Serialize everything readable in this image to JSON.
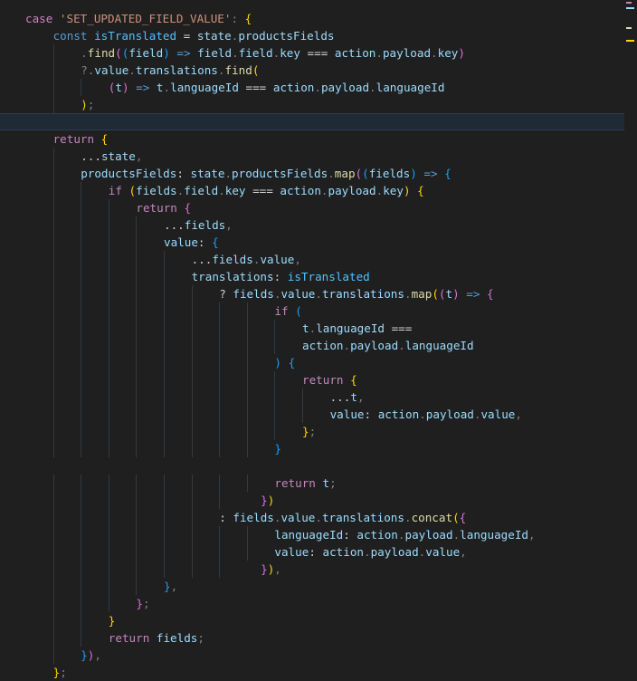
{
  "colors": {
    "background": "#1f1f1f",
    "current_line": "#1e2a35",
    "keyword_control": "#c586c0",
    "keyword_storage": "#569cd6",
    "variable": "#9cdcfe",
    "constant": "#4fc1ff",
    "function": "#dcdcaa",
    "string": "#ce9178",
    "punctuation": "#d4d4d4",
    "dim_punctuation": "#808080",
    "bracket1": "#ffd700",
    "bracket2": "#da70d6",
    "bracket3": "#179fff"
  },
  "editor": {
    "lines": [
      {
        "indent": 0,
        "tokens": [
          {
            "t": "case ",
            "c": "keyword_control"
          },
          {
            "t": "'SET_UPDATED_FIELD_VALUE'",
            "c": "string"
          },
          {
            "t": ": ",
            "c": "dim_punctuation"
          },
          {
            "t": "{",
            "c": "bracket1"
          }
        ]
      },
      {
        "indent": 1,
        "tokens": [
          {
            "t": "const ",
            "c": "keyword_storage"
          },
          {
            "t": "isTranslated",
            "c": "constant"
          },
          {
            "t": " = ",
            "c": "punctuation"
          },
          {
            "t": "state",
            "c": "variable"
          },
          {
            "t": ".",
            "c": "dim_punctuation"
          },
          {
            "t": "productsFields",
            "c": "variable"
          }
        ]
      },
      {
        "indent": 2,
        "tokens": [
          {
            "t": ".",
            "c": "dim_punctuation"
          },
          {
            "t": "find",
            "c": "function"
          },
          {
            "t": "(",
            "c": "bracket2"
          },
          {
            "t": "(",
            "c": "bracket3"
          },
          {
            "t": "field",
            "c": "variable"
          },
          {
            "t": ")",
            "c": "bracket3"
          },
          {
            "t": " => ",
            "c": "keyword_storage"
          },
          {
            "t": "field",
            "c": "variable"
          },
          {
            "t": ".",
            "c": "dim_punctuation"
          },
          {
            "t": "field",
            "c": "variable"
          },
          {
            "t": ".",
            "c": "dim_punctuation"
          },
          {
            "t": "key",
            "c": "variable"
          },
          {
            "t": " === ",
            "c": "punctuation"
          },
          {
            "t": "action",
            "c": "variable"
          },
          {
            "t": ".",
            "c": "dim_punctuation"
          },
          {
            "t": "payload",
            "c": "variable"
          },
          {
            "t": ".",
            "c": "dim_punctuation"
          },
          {
            "t": "key",
            "c": "variable"
          },
          {
            "t": ")",
            "c": "bracket2"
          }
        ]
      },
      {
        "indent": 2,
        "tokens": [
          {
            "t": "?.",
            "c": "dim_punctuation"
          },
          {
            "t": "value",
            "c": "variable"
          },
          {
            "t": ".",
            "c": "dim_punctuation"
          },
          {
            "t": "translations",
            "c": "variable"
          },
          {
            "t": ".",
            "c": "dim_punctuation"
          },
          {
            "t": "find",
            "c": "function"
          },
          {
            "t": "(",
            "c": "bracket1"
          }
        ]
      },
      {
        "indent": 3,
        "tokens": [
          {
            "t": "(",
            "c": "bracket2"
          },
          {
            "t": "t",
            "c": "variable"
          },
          {
            "t": ")",
            "c": "bracket2"
          },
          {
            "t": " => ",
            "c": "keyword_storage"
          },
          {
            "t": "t",
            "c": "variable"
          },
          {
            "t": ".",
            "c": "dim_punctuation"
          },
          {
            "t": "languageId",
            "c": "variable"
          },
          {
            "t": " === ",
            "c": "punctuation"
          },
          {
            "t": "action",
            "c": "variable"
          },
          {
            "t": ".",
            "c": "dim_punctuation"
          },
          {
            "t": "payload",
            "c": "variable"
          },
          {
            "t": ".",
            "c": "dim_punctuation"
          },
          {
            "t": "languageId",
            "c": "variable"
          }
        ]
      },
      {
        "indent": 2,
        "tokens": [
          {
            "t": ")",
            "c": "bracket1"
          },
          {
            "t": ";",
            "c": "dim_punctuation"
          }
        ]
      },
      {
        "indent": 0,
        "current": true,
        "tokens": []
      },
      {
        "indent": 1,
        "tokens": [
          {
            "t": "return ",
            "c": "keyword_control"
          },
          {
            "t": "{",
            "c": "bracket1"
          }
        ]
      },
      {
        "indent": 2,
        "tokens": [
          {
            "t": "...",
            "c": "punctuation"
          },
          {
            "t": "state",
            "c": "variable"
          },
          {
            "t": ",",
            "c": "dim_punctuation"
          }
        ]
      },
      {
        "indent": 2,
        "tokens": [
          {
            "t": "productsFields",
            "c": "variable"
          },
          {
            "t": ": ",
            "c": "punctuation"
          },
          {
            "t": "state",
            "c": "variable"
          },
          {
            "t": ".",
            "c": "dim_punctuation"
          },
          {
            "t": "productsFields",
            "c": "variable"
          },
          {
            "t": ".",
            "c": "dim_punctuation"
          },
          {
            "t": "map",
            "c": "function"
          },
          {
            "t": "(",
            "c": "bracket2"
          },
          {
            "t": "(",
            "c": "bracket3"
          },
          {
            "t": "fields",
            "c": "variable"
          },
          {
            "t": ")",
            "c": "bracket3"
          },
          {
            "t": " => ",
            "c": "keyword_storage"
          },
          {
            "t": "{",
            "c": "bracket3"
          }
        ]
      },
      {
        "indent": 3,
        "tokens": [
          {
            "t": "if ",
            "c": "keyword_control"
          },
          {
            "t": "(",
            "c": "bracket1"
          },
          {
            "t": "fields",
            "c": "variable"
          },
          {
            "t": ".",
            "c": "dim_punctuation"
          },
          {
            "t": "field",
            "c": "variable"
          },
          {
            "t": ".",
            "c": "dim_punctuation"
          },
          {
            "t": "key",
            "c": "variable"
          },
          {
            "t": " === ",
            "c": "punctuation"
          },
          {
            "t": "action",
            "c": "variable"
          },
          {
            "t": ".",
            "c": "dim_punctuation"
          },
          {
            "t": "payload",
            "c": "variable"
          },
          {
            "t": ".",
            "c": "dim_punctuation"
          },
          {
            "t": "key",
            "c": "variable"
          },
          {
            "t": ")",
            "c": "bracket1"
          },
          {
            "t": " ",
            "c": "punctuation"
          },
          {
            "t": "{",
            "c": "bracket1"
          }
        ]
      },
      {
        "indent": 4,
        "tokens": [
          {
            "t": "return ",
            "c": "keyword_control"
          },
          {
            "t": "{",
            "c": "bracket2"
          }
        ]
      },
      {
        "indent": 5,
        "tokens": [
          {
            "t": "...",
            "c": "punctuation"
          },
          {
            "t": "fields",
            "c": "variable"
          },
          {
            "t": ",",
            "c": "dim_punctuation"
          }
        ]
      },
      {
        "indent": 5,
        "tokens": [
          {
            "t": "value",
            "c": "variable"
          },
          {
            "t": ": ",
            "c": "punctuation"
          },
          {
            "t": "{",
            "c": "bracket3"
          }
        ]
      },
      {
        "indent": 6,
        "tokens": [
          {
            "t": "...",
            "c": "punctuation"
          },
          {
            "t": "fields",
            "c": "variable"
          },
          {
            "t": ".",
            "c": "dim_punctuation"
          },
          {
            "t": "value",
            "c": "variable"
          },
          {
            "t": ",",
            "c": "dim_punctuation"
          }
        ]
      },
      {
        "indent": 6,
        "tokens": [
          {
            "t": "translations",
            "c": "variable"
          },
          {
            "t": ": ",
            "c": "punctuation"
          },
          {
            "t": "isTranslated",
            "c": "constant"
          }
        ]
      },
      {
        "indent": 7,
        "tokens": [
          {
            "t": "? ",
            "c": "punctuation"
          },
          {
            "t": "fields",
            "c": "variable"
          },
          {
            "t": ".",
            "c": "dim_punctuation"
          },
          {
            "t": "value",
            "c": "variable"
          },
          {
            "t": ".",
            "c": "dim_punctuation"
          },
          {
            "t": "translations",
            "c": "variable"
          },
          {
            "t": ".",
            "c": "dim_punctuation"
          },
          {
            "t": "map",
            "c": "function"
          },
          {
            "t": "(",
            "c": "bracket1"
          },
          {
            "t": "(",
            "c": "bracket2"
          },
          {
            "t": "t",
            "c": "variable"
          },
          {
            "t": ")",
            "c": "bracket2"
          },
          {
            "t": " => ",
            "c": "keyword_storage"
          },
          {
            "t": "{",
            "c": "bracket2"
          }
        ]
      },
      {
        "indent": 9,
        "tokens": [
          {
            "t": "if ",
            "c": "keyword_control"
          },
          {
            "t": "(",
            "c": "bracket3"
          }
        ]
      },
      {
        "indent": 10,
        "tokens": [
          {
            "t": "t",
            "c": "variable"
          },
          {
            "t": ".",
            "c": "dim_punctuation"
          },
          {
            "t": "languageId",
            "c": "variable"
          },
          {
            "t": " ===",
            "c": "punctuation"
          }
        ]
      },
      {
        "indent": 10,
        "tokens": [
          {
            "t": "action",
            "c": "variable"
          },
          {
            "t": ".",
            "c": "dim_punctuation"
          },
          {
            "t": "payload",
            "c": "variable"
          },
          {
            "t": ".",
            "c": "dim_punctuation"
          },
          {
            "t": "languageId",
            "c": "variable"
          }
        ]
      },
      {
        "indent": 9,
        "tokens": [
          {
            "t": ")",
            "c": "bracket3"
          },
          {
            "t": " ",
            "c": "punctuation"
          },
          {
            "t": "{",
            "c": "bracket3"
          }
        ]
      },
      {
        "indent": 10,
        "tokens": [
          {
            "t": "return ",
            "c": "keyword_control"
          },
          {
            "t": "{",
            "c": "bracket1"
          }
        ]
      },
      {
        "indent": 11,
        "tokens": [
          {
            "t": "...",
            "c": "punctuation"
          },
          {
            "t": "t",
            "c": "variable"
          },
          {
            "t": ",",
            "c": "dim_punctuation"
          }
        ]
      },
      {
        "indent": 11,
        "tokens": [
          {
            "t": "value",
            "c": "variable"
          },
          {
            "t": ": ",
            "c": "punctuation"
          },
          {
            "t": "action",
            "c": "variable"
          },
          {
            "t": ".",
            "c": "dim_punctuation"
          },
          {
            "t": "payload",
            "c": "variable"
          },
          {
            "t": ".",
            "c": "dim_punctuation"
          },
          {
            "t": "value",
            "c": "variable"
          },
          {
            "t": ",",
            "c": "dim_punctuation"
          }
        ]
      },
      {
        "indent": 10,
        "tokens": [
          {
            "t": "}",
            "c": "bracket1"
          },
          {
            "t": ";",
            "c": "dim_punctuation"
          }
        ]
      },
      {
        "indent": 9,
        "tokens": [
          {
            "t": "}",
            "c": "bracket3"
          }
        ]
      },
      {
        "indent": 0,
        "tokens": []
      },
      {
        "indent": 9,
        "tokens": [
          {
            "t": "return ",
            "c": "keyword_control"
          },
          {
            "t": "t",
            "c": "variable"
          },
          {
            "t": ";",
            "c": "dim_punctuation"
          }
        ]
      },
      {
        "indent": 8,
        "pad": 2,
        "tokens": [
          {
            "t": "}",
            "c": "bracket2"
          },
          {
            "t": ")",
            "c": "bracket1"
          }
        ]
      },
      {
        "indent": 7,
        "tokens": [
          {
            "t": ": ",
            "c": "punctuation"
          },
          {
            "t": "fields",
            "c": "variable"
          },
          {
            "t": ".",
            "c": "dim_punctuation"
          },
          {
            "t": "value",
            "c": "variable"
          },
          {
            "t": ".",
            "c": "dim_punctuation"
          },
          {
            "t": "translations",
            "c": "variable"
          },
          {
            "t": ".",
            "c": "dim_punctuation"
          },
          {
            "t": "concat",
            "c": "function"
          },
          {
            "t": "(",
            "c": "bracket1"
          },
          {
            "t": "{",
            "c": "bracket2"
          }
        ]
      },
      {
        "indent": 9,
        "tokens": [
          {
            "t": "languageId",
            "c": "variable"
          },
          {
            "t": ": ",
            "c": "punctuation"
          },
          {
            "t": "action",
            "c": "variable"
          },
          {
            "t": ".",
            "c": "dim_punctuation"
          },
          {
            "t": "payload",
            "c": "variable"
          },
          {
            "t": ".",
            "c": "dim_punctuation"
          },
          {
            "t": "languageId",
            "c": "variable"
          },
          {
            "t": ",",
            "c": "dim_punctuation"
          }
        ]
      },
      {
        "indent": 9,
        "tokens": [
          {
            "t": "value",
            "c": "variable"
          },
          {
            "t": ": ",
            "c": "punctuation"
          },
          {
            "t": "action",
            "c": "variable"
          },
          {
            "t": ".",
            "c": "dim_punctuation"
          },
          {
            "t": "payload",
            "c": "variable"
          },
          {
            "t": ".",
            "c": "dim_punctuation"
          },
          {
            "t": "value",
            "c": "variable"
          },
          {
            "t": ",",
            "c": "dim_punctuation"
          }
        ]
      },
      {
        "indent": 8,
        "pad": 2,
        "tokens": [
          {
            "t": "}",
            "c": "bracket2"
          },
          {
            "t": ")",
            "c": "bracket1"
          },
          {
            "t": ",",
            "c": "dim_punctuation"
          }
        ]
      },
      {
        "indent": 5,
        "tokens": [
          {
            "t": "}",
            "c": "bracket3"
          },
          {
            "t": ",",
            "c": "dim_punctuation"
          }
        ]
      },
      {
        "indent": 4,
        "tokens": [
          {
            "t": "}",
            "c": "bracket2"
          },
          {
            "t": ";",
            "c": "dim_punctuation"
          }
        ]
      },
      {
        "indent": 3,
        "tokens": [
          {
            "t": "}",
            "c": "bracket1"
          }
        ]
      },
      {
        "indent": 3,
        "tokens": [
          {
            "t": "return ",
            "c": "keyword_control"
          },
          {
            "t": "fields",
            "c": "variable"
          },
          {
            "t": ";",
            "c": "dim_punctuation"
          }
        ]
      },
      {
        "indent": 2,
        "tokens": [
          {
            "t": "}",
            "c": "bracket3"
          },
          {
            "t": ")",
            "c": "bracket2"
          },
          {
            "t": ",",
            "c": "dim_punctuation"
          }
        ]
      },
      {
        "indent": 1,
        "tokens": [
          {
            "t": "}",
            "c": "bracket1"
          },
          {
            "t": ";",
            "c": "dim_punctuation"
          }
        ]
      }
    ]
  }
}
